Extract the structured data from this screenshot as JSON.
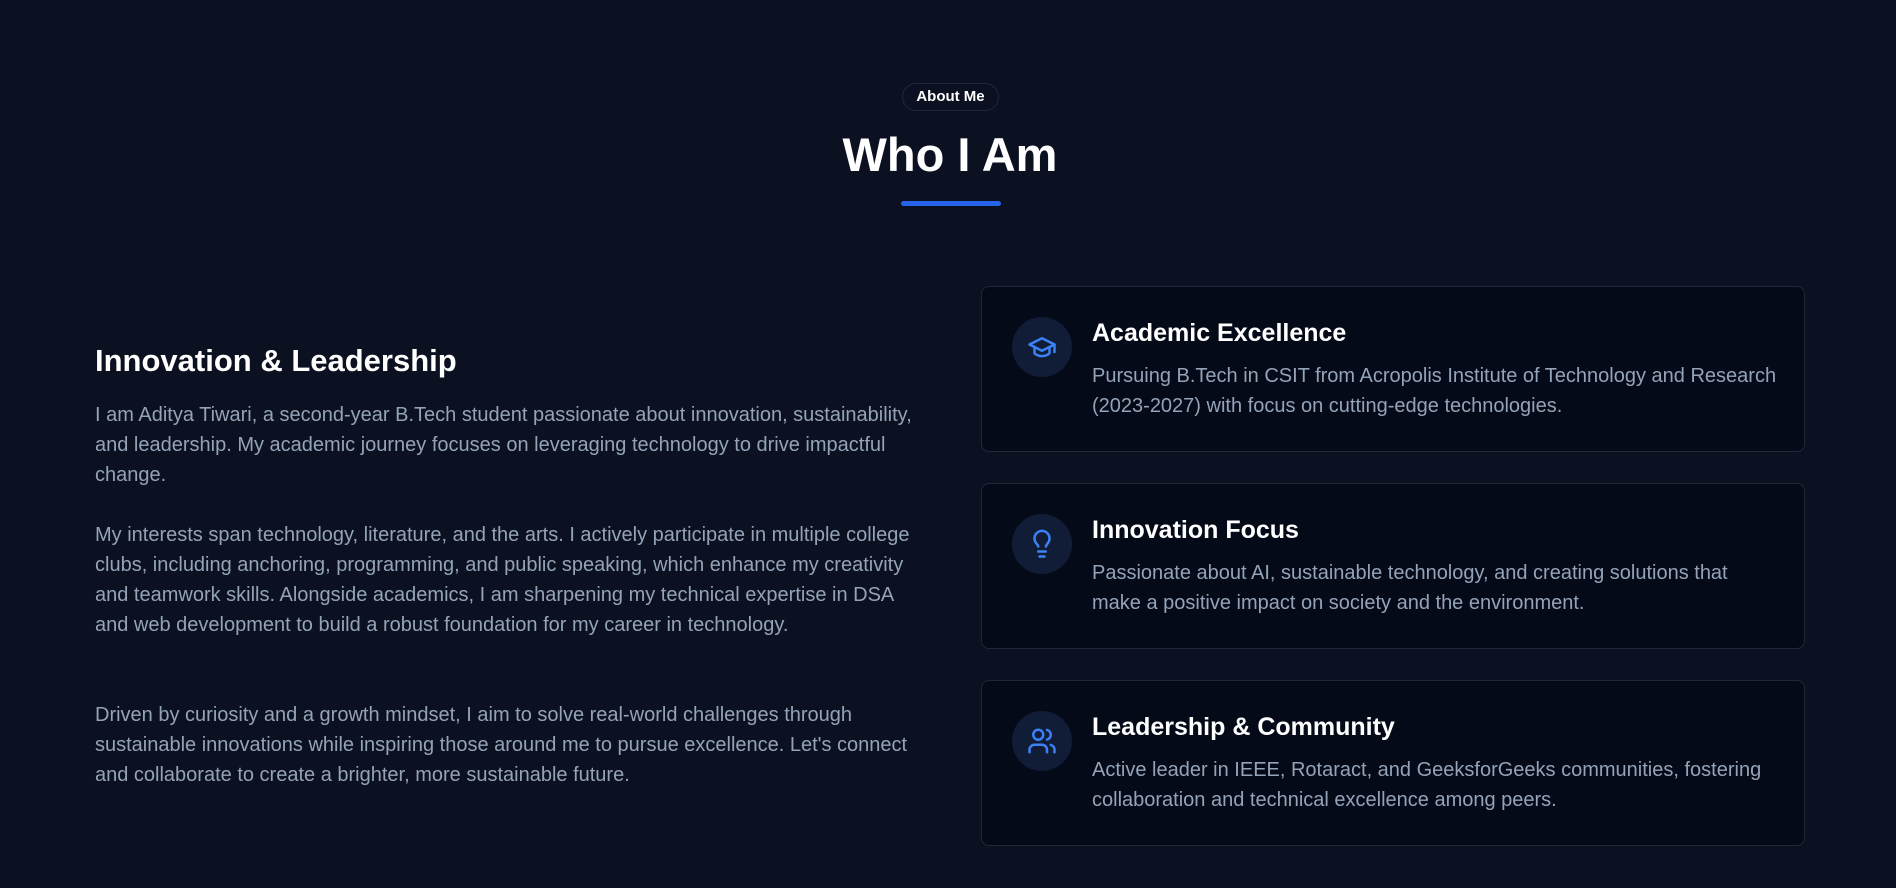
{
  "header": {
    "badge": "About Me",
    "title": "Who I Am",
    "accent_color": "#2563eb"
  },
  "intro": {
    "heading": "Innovation & Leadership",
    "paragraphs": [
      "I am Aditya Tiwari, a second-year B.Tech student passionate about innovation, sustainability, and leadership. My academic journey focuses on leveraging technology to drive impactful change.",
      "My interests span technology, literature, and the arts. I actively participate in multiple college clubs, including anchoring, programming, and public speaking, which enhance my creativity and teamwork skills. Alongside academics, I am sharpening my technical expertise in DSA and web development to build a robust foundation for my career in technology.",
      "Driven by curiosity and a growth mindset, I aim to solve real-world challenges through sustainable innovations while inspiring those around me to pursue excellence. Let's connect and collaborate to create a brighter, more sustainable future."
    ]
  },
  "cards": [
    {
      "icon": "graduation-cap-icon",
      "title": "Academic Excellence",
      "description": "Pursuing B.Tech in CSIT from Acropolis Institute of Technology and Research (2023-2027) with focus on cutting-edge technologies."
    },
    {
      "icon": "lightbulb-icon",
      "title": "Innovation Focus",
      "description": "Passionate about AI, sustainable technology, and creating solutions that make a positive impact on society and the environment."
    },
    {
      "icon": "users-icon",
      "title": "Leadership & Community",
      "description": "Active leader in IEEE, Rotaract, and GeeksforGeeks communities, fostering collaboration and technical excellence among peers."
    }
  ]
}
